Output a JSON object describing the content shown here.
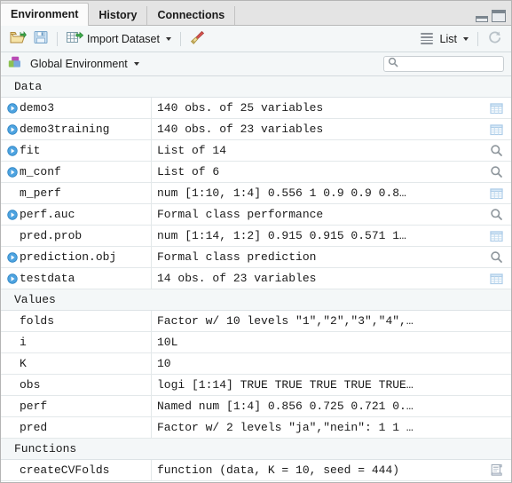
{
  "window": {
    "minimize_icon": "minimize-icon",
    "maximize_icon": "maximize-icon"
  },
  "tabs": [
    {
      "label": "Environment",
      "active": true
    },
    {
      "label": "History",
      "active": false
    },
    {
      "label": "Connections",
      "active": false
    }
  ],
  "toolbar": {
    "load_workspace_icon": "open-folder-icon",
    "save_workspace_icon": "save-disk-icon",
    "import_dataset_label": "Import Dataset",
    "import_dataset_icon": "import-grid-icon",
    "clear_icon": "broom-icon",
    "view_mode_label": "List",
    "view_mode_icon": "list-lines-icon",
    "refresh_icon": "refresh-icon"
  },
  "envbar": {
    "environment_label": "Global Environment",
    "environment_icon": "environment-cubes-icon",
    "search_placeholder": "",
    "search_value": "",
    "search_icon": "search-icon"
  },
  "sections": [
    {
      "title": "Data",
      "rows": [
        {
          "name": "demo3",
          "value": "140 obs. of 25 variables",
          "expandable": true,
          "action": "table-icon"
        },
        {
          "name": "demo3training",
          "value": "140 obs. of 23 variables",
          "expandable": true,
          "action": "table-icon"
        },
        {
          "name": "fit",
          "value": "List of 14",
          "expandable": true,
          "action": "magnifier-icon"
        },
        {
          "name": "m_conf",
          "value": "List of 6",
          "expandable": true,
          "action": "magnifier-icon"
        },
        {
          "name": "m_perf",
          "value": "num [1:10, 1:4] 0.556 1 0.9 0.9 0.8…",
          "expandable": false,
          "action": "table-icon"
        },
        {
          "name": "perf.auc",
          "value": "Formal class performance",
          "expandable": true,
          "action": "magnifier-icon"
        },
        {
          "name": "pred.prob",
          "value": "num [1:14, 1:2] 0.915 0.915 0.571 1…",
          "expandable": false,
          "action": "table-icon"
        },
        {
          "name": "prediction.obj",
          "value": "Formal class prediction",
          "expandable": true,
          "action": "magnifier-icon"
        },
        {
          "name": "testdata",
          "value": "14 obs. of 23 variables",
          "expandable": true,
          "action": "table-icon"
        }
      ]
    },
    {
      "title": "Values",
      "rows": [
        {
          "name": "folds",
          "value": "Factor w/ 10 levels \"1\",\"2\",\"3\",\"4\",…",
          "expandable": false,
          "action": "none"
        },
        {
          "name": "i",
          "value": "10L",
          "expandable": false,
          "action": "none"
        },
        {
          "name": "K",
          "value": "10",
          "expandable": false,
          "action": "none"
        },
        {
          "name": "obs",
          "value": "logi [1:14] TRUE TRUE TRUE TRUE TRUE…",
          "expandable": false,
          "action": "none"
        },
        {
          "name": "perf",
          "value": "Named num [1:4] 0.856 0.725 0.721 0.…",
          "expandable": false,
          "action": "none"
        },
        {
          "name": "pred",
          "value": "Factor w/ 2 levels \"ja\",\"nein\": 1 1 …",
          "expandable": false,
          "action": "none"
        }
      ]
    },
    {
      "title": "Functions",
      "rows": [
        {
          "name": "createCVFolds",
          "value": "function (data, K = 10, seed = 444)",
          "expandable": false,
          "action": "script-icon"
        }
      ]
    }
  ],
  "colors": {
    "tab_active_bg": "#fbfbfb",
    "tabbar_bg": "#e4e4e4",
    "toolbar_bg": "#f4f7f8",
    "section_bg": "#f4f7f8",
    "row_border": "#e3e8ea",
    "expander_blue": "#4da3e0",
    "table_icon_blue": "#aecde8",
    "magnifier_gray": "#8d959b",
    "text": "#1a1a1a"
  }
}
